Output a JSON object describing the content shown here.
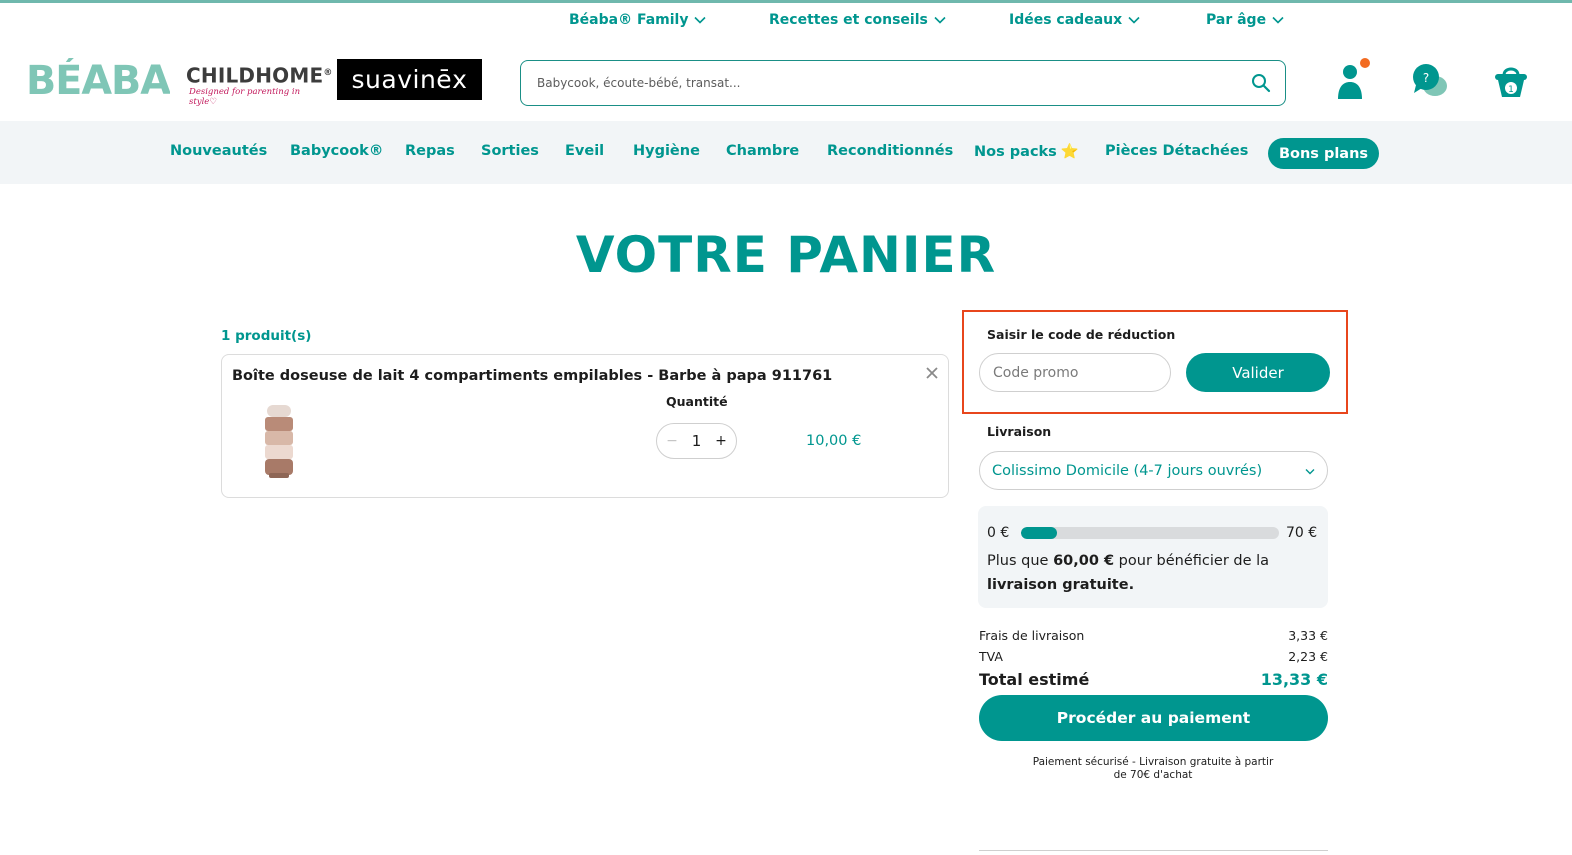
{
  "util_nav": [
    {
      "label": "Béaba® Family"
    },
    {
      "label": "Recettes et conseils"
    },
    {
      "label": "Idées cadeaux"
    },
    {
      "label": "Par âge"
    }
  ],
  "brands": {
    "beaba": "BÉABA",
    "childhome": "CHILDHOME",
    "childhome_mark": "®",
    "childhome_tagline": "Designed for parenting in style♡",
    "suavinex": "suavinēx"
  },
  "search": {
    "placeholder": "Babycook, écoute-bébé, transat..."
  },
  "header_icons": {
    "cart_count": "1",
    "help_symbol": "?"
  },
  "categories": [
    {
      "label": "Nouveautés"
    },
    {
      "label": "Babycook®"
    },
    {
      "label": "Repas"
    },
    {
      "label": "Sorties"
    },
    {
      "label": "Eveil"
    },
    {
      "label": "Hygiène"
    },
    {
      "label": "Chambre"
    },
    {
      "label": "Reconditionnés"
    },
    {
      "label": "Nos packs",
      "emoji": "⭐"
    },
    {
      "label": "Pièces Détachées"
    }
  ],
  "deals_label": "Bons plans",
  "page_title": "VOTRE PANIER",
  "cart": {
    "count_label": "1 produit(s)",
    "items": [
      {
        "name": "Boîte doseuse de lait 4 compartiments empilables - Barbe à papa 911761",
        "quantity_label": "Quantité",
        "quantity": "1",
        "price": "10,00 €"
      }
    ]
  },
  "promo": {
    "label": "Saisir le code de réduction",
    "placeholder": "Code promo",
    "button": "Valider"
  },
  "shipping": {
    "label": "Livraison",
    "selected": "Colissimo Domicile (4-7 jours ouvrés)"
  },
  "free_shipping": {
    "min": "0 €",
    "max": "70 €",
    "progress_fraction": 0.14,
    "text_before": "Plus que ",
    "amount": "60,00 €",
    "text_middle": " pour bénéficier de la ",
    "text_bold": "livraison gratuite."
  },
  "summary": {
    "shipping_label": "Frais de livraison",
    "shipping_value": "3,33 €",
    "tax_label": "TVA",
    "tax_value": "2,23 €",
    "total_label": "Total estimé",
    "total_value": "13,33 €"
  },
  "checkout_button": "Procéder au paiement",
  "secure_note": "Paiement sécurisé - Livraison gratuite à partir de 70€ d'achat",
  "colors": {
    "brand_teal": "#00968f",
    "highlight_border": "#e8461c",
    "notification_dot": "#f26b21"
  }
}
